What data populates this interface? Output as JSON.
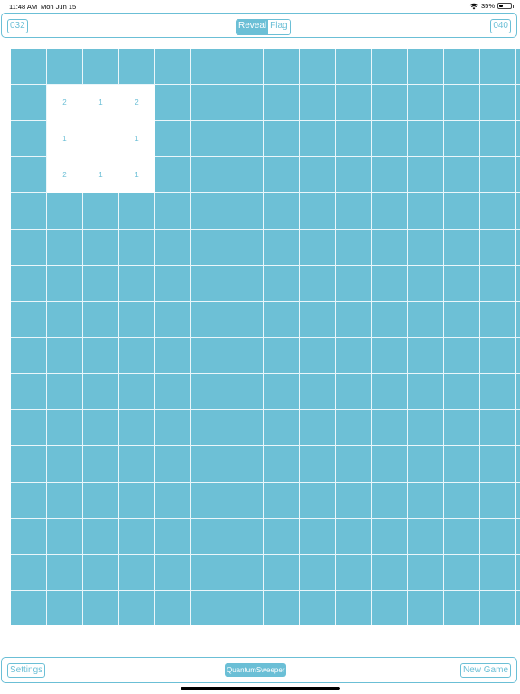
{
  "status": {
    "time": "11:48 AM",
    "date": "Mon Jun 15",
    "battery": "35%",
    "battery_level": 0.35
  },
  "top_bar": {
    "left_counter": "032",
    "mode_reveal": "Reveal",
    "mode_flag": "Flag",
    "active_mode": "Reveal",
    "right_counter": "040"
  },
  "board": {
    "columns": 15,
    "rows": 16,
    "revealed": [
      {
        "row": 1,
        "col": 1,
        "value": "2"
      },
      {
        "row": 1,
        "col": 2,
        "value": "1"
      },
      {
        "row": 1,
        "col": 3,
        "value": "2"
      },
      {
        "row": 2,
        "col": 1,
        "value": "1"
      },
      {
        "row": 2,
        "col": 2,
        "value": ""
      },
      {
        "row": 2,
        "col": 3,
        "value": "1"
      },
      {
        "row": 3,
        "col": 1,
        "value": "2"
      },
      {
        "row": 3,
        "col": 2,
        "value": "1"
      },
      {
        "row": 3,
        "col": 3,
        "value": "1"
      }
    ]
  },
  "bottom_bar": {
    "settings_label": "Settings",
    "title": "QuantumSweeper",
    "new_game_label": "New Game"
  },
  "colors": {
    "accent": "#6bbfd6",
    "cell": "#6dc0d6",
    "revealed": "#ffffff"
  }
}
